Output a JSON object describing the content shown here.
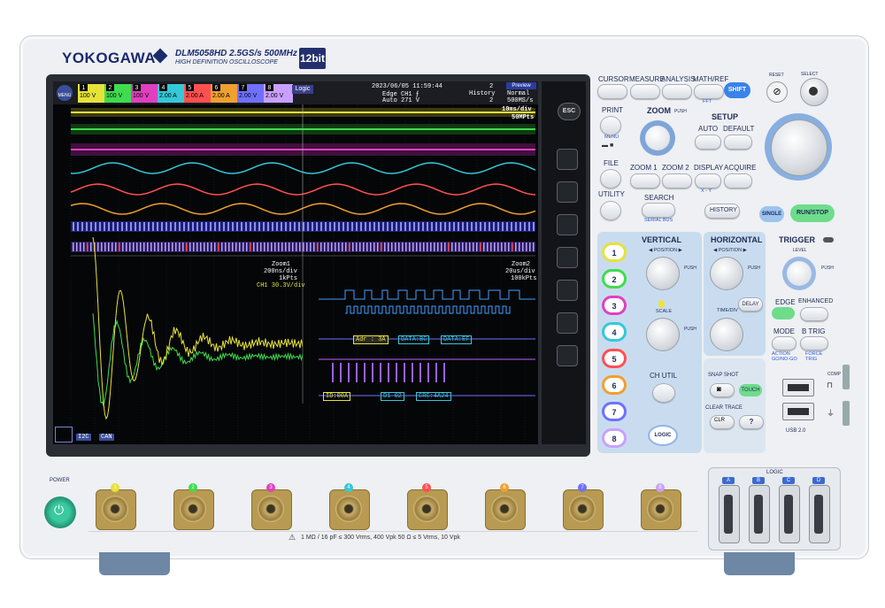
{
  "brand": {
    "name": "YOKOGAWA",
    "model": "DLM5058HD   2.5GS/s 500MHz",
    "subtitle": "HIGH DEFINITION OSCILLOSCOPE",
    "bits": "12bit"
  },
  "screen": {
    "menu_label": "MENU",
    "channels": [
      {
        "n": "1",
        "v": "100 V",
        "color": "#e6e23a"
      },
      {
        "n": "2",
        "v": "100 V",
        "color": "#3fdc4f"
      },
      {
        "n": "3",
        "v": "100 V",
        "color": "#e040c0"
      },
      {
        "n": "4",
        "v": "2.00 A",
        "color": "#35c8d8"
      },
      {
        "n": "5",
        "v": "2.00 A",
        "color": "#ff5050"
      },
      {
        "n": "6",
        "v": "2.00 A",
        "color": "#f0a030"
      },
      {
        "n": "7",
        "v": "2.00 V",
        "color": "#7070ff"
      },
      {
        "n": "8",
        "v": "2.00 V",
        "color": "#c9a0ff"
      }
    ],
    "logic_label": "Logic",
    "datetime": "2023/06/05 11:59:44",
    "acq_count": "2",
    "preview": "Preview",
    "trigger_line1": "Edge CH1 ⨍",
    "trigger_line2": "Auto 271 V",
    "history_label": "History",
    "history_value": "2",
    "mode_label": "Normal",
    "sample_rate": "500MS/s",
    "timebase": "10ms/div",
    "record_length": "50MPts",
    "zoom1_title": "Zoom1",
    "zoom1_tdiv": "200ns/div",
    "zoom1_pts": "1kPts",
    "zoom1_ch": "CH1 30.3V/div",
    "zoom2_title": "Zoom2",
    "zoom2_tdiv": "20us/div",
    "zoom2_pts": "100kPts",
    "decode_a": "Adr : 3A",
    "decode_b": "DATA:BC",
    "decode_c": "DATA:EF",
    "decode_d": "ID:00A",
    "decode_e": "D1 02",
    "decode_f": "CRC:4A24",
    "bus1": "I2C",
    "bus2": "CAN"
  },
  "controls": {
    "esc": "ESC",
    "cursor": "CURSOR",
    "measure": "MEASURE",
    "analysis": "ANALYSIS",
    "mathref": "MATH/REF",
    "fft": "FFT",
    "shift": "SHIFT",
    "print": "PRINT",
    "menu_sub": "MENU",
    "file": "FILE",
    "utility": "UTILITY",
    "zoom": "ZOOM",
    "push": "PUSH",
    "setup": "SETUP",
    "auto": "AUTO",
    "default": "DEFAULT",
    "zoom1": "ZOOM 1",
    "zoom2": "ZOOM 2",
    "display": "DISPLAY",
    "xy": "X - Y",
    "acquire": "ACQUIRE",
    "search": "SEARCH",
    "serial_bus": "SERIAL BUS",
    "history": "HISTORY",
    "single": "SINGLE",
    "runstop": "RUN/STOP",
    "reset": "RESET",
    "select": "SELECT",
    "vertical": "VERTICAL",
    "position": "◀ POSITION ▶",
    "scale": "SCALE",
    "horizontal": "HORIZONTAL",
    "hposition": "◀ POSITION ▶",
    "timediv": "TIME/DIV",
    "delay": "DELAY",
    "trigger": "TRIGGER",
    "level": "LEVEL",
    "edge": "EDGE",
    "enhanced": "ENHANCED",
    "mode": "MODE",
    "btrig": "B TRIG",
    "action": "ACTION\nGO/NO-GO",
    "force": "FORCE\nTRIG",
    "ch_util": "CH UTIL",
    "logic": "LOGIC",
    "snapshot": "SNAP SHOT",
    "touch": "TOUCH",
    "clear_trace": "CLEAR TRACE",
    "help": "?",
    "usb": "USB 2.0",
    "comp": "COMP",
    "ch_buttons": [
      "1",
      "2",
      "3",
      "4",
      "5",
      "6",
      "7",
      "8"
    ]
  },
  "front": {
    "power": "POWER",
    "logic": "LOGIC",
    "logic_ports": [
      "A",
      "B",
      "C",
      "D"
    ],
    "warning": "1 MΩ / 16 pF ≤ 300 Vrms, 400 Vpk    50 Ω ≤ 5 Vrms, 10 Vpk",
    "inputs": [
      "1",
      "2",
      "3",
      "4",
      "5",
      "6",
      "7",
      "8"
    ]
  }
}
